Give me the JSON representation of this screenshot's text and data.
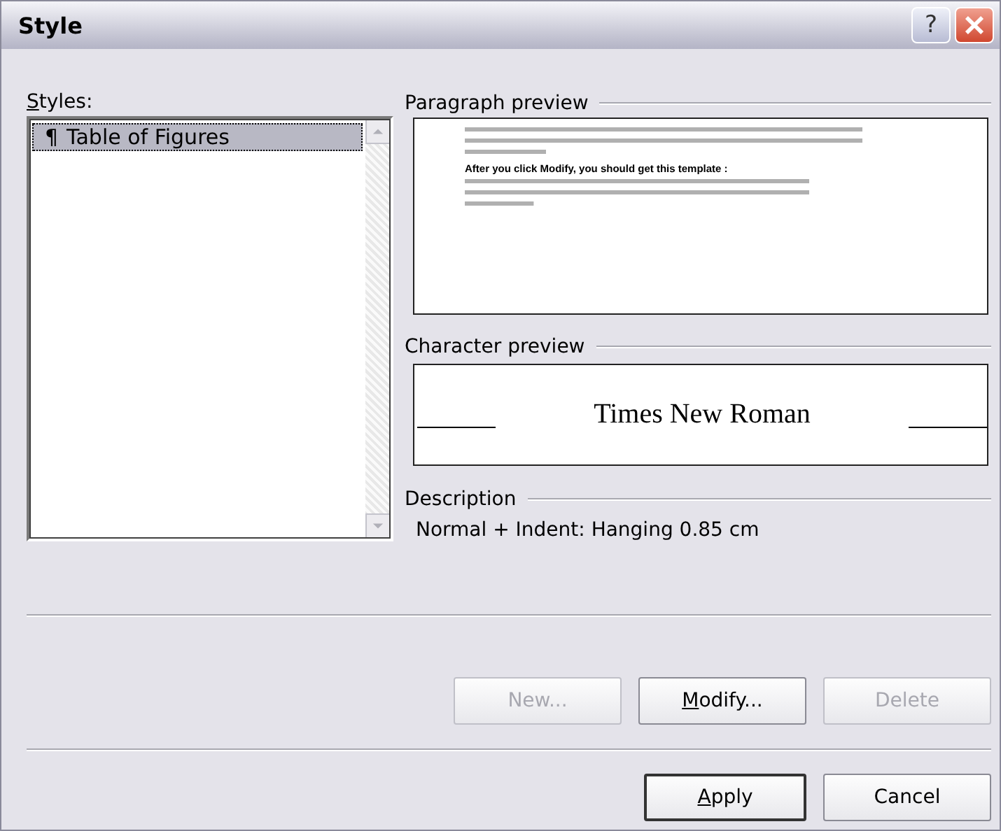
{
  "window": {
    "title": "Style",
    "help_button": "?"
  },
  "styles": {
    "label": [
      {
        "text": "S",
        "underlined": true
      },
      {
        "text": "tyles:",
        "underlined": false
      }
    ],
    "items": [
      {
        "mark": "¶",
        "name": "Table of Figures",
        "selected": true
      }
    ]
  },
  "paragraph_preview": {
    "label": "Paragraph preview",
    "sample": "After you click Modify, you should get this template :"
  },
  "character_preview": {
    "label": "Character preview",
    "sample": "Times New Roman"
  },
  "description": {
    "label": "Description",
    "text": "Normal + Indent:  Hanging  0.85 cm"
  },
  "buttons": [
    {
      "label": [
        {
          "text": "New...",
          "underlined": false
        }
      ],
      "disabled": true
    },
    {
      "label": [
        {
          "text": "M",
          "underlined": true
        },
        {
          "text": "odify...",
          "underlined": false
        }
      ],
      "disabled": false
    },
    {
      "label": [
        {
          "text": "Delete",
          "underlined": false
        }
      ],
      "disabled": true
    }
  ],
  "footer_buttons": [
    {
      "label": [
        {
          "text": "A",
          "underlined": true
        },
        {
          "text": "pply",
          "underlined": false
        }
      ],
      "default": true
    },
    {
      "label": [
        {
          "text": "Cancel",
          "underlined": false
        }
      ],
      "default": false
    }
  ]
}
